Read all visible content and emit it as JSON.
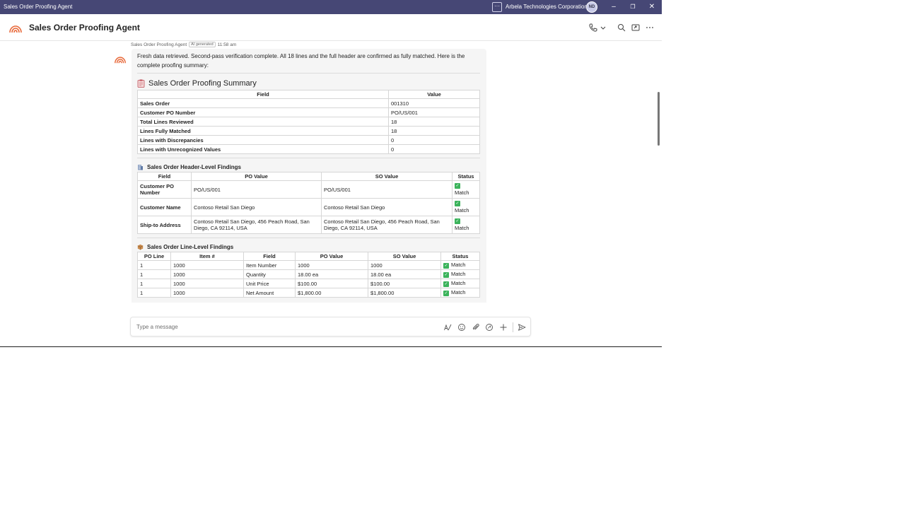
{
  "window": {
    "title": "Sales Order Proofing Agent",
    "org": "Arbela Technologies Corporation",
    "avatar_initials": "ND",
    "more_label": "···",
    "minimize_glyph": "–",
    "restore_glyph": "❐",
    "close_glyph": "✕"
  },
  "header": {
    "app_title": "Sales Order Proofing Agent",
    "icons": [
      "phone-icon",
      "chevron-down-icon",
      "search-icon",
      "popout-icon",
      "more-icon"
    ]
  },
  "message": {
    "sender": "Sales Order Proofing Agent",
    "ai_badge": "AI generated",
    "time": "11:58 am",
    "intro": "Fresh data retrieved. Second-pass verification complete. All 18 lines and the full header are confirmed as fully matched. Here is the complete proofing summary:"
  },
  "summary": {
    "title": "Sales Order Proofing Summary",
    "headers": [
      "Field",
      "Value"
    ],
    "rows": [
      [
        "Sales Order",
        "001310"
      ],
      [
        "Customer PO Number",
        "PO/US/001"
      ],
      [
        "Total Lines Reviewed",
        "18"
      ],
      [
        "Lines Fully Matched",
        "18"
      ],
      [
        "Lines with Discrepancies",
        "0"
      ],
      [
        "Lines with Unrecognized Values",
        "0"
      ]
    ]
  },
  "header_findings": {
    "title": "Sales Order Header-Level Findings",
    "headers": [
      "Field",
      "PO Value",
      "SO Value",
      "Status"
    ],
    "rows": [
      [
        "Customer PO Number",
        "PO/US/001",
        "PO/US/001",
        "Match"
      ],
      [
        "Customer Name",
        "Contoso Retail San Diego",
        "Contoso Retail San Diego",
        "Match"
      ],
      [
        "Ship-to Address",
        "Contoso Retail San Diego, 456 Peach Road, San Diego, CA 92114, USA",
        "Contoso Retail San Diego, 456 Peach Road, San Diego, CA 92114, USA",
        "Match"
      ]
    ]
  },
  "line_findings": {
    "title": "Sales Order Line-Level Findings",
    "headers": [
      "PO Line",
      "Item #",
      "Field",
      "PO Value",
      "SO Value",
      "Status"
    ],
    "rows": [
      [
        "1",
        "1000",
        "Item Number",
        "1000",
        "1000",
        "Match"
      ],
      [
        "1",
        "1000",
        "Quantity",
        "18.00 ea",
        "18.00 ea",
        "Match"
      ],
      [
        "1",
        "1000",
        "Unit Price",
        "$100.00",
        "$100.00",
        "Match"
      ],
      [
        "1",
        "1000",
        "Net Amount",
        "$1,800.00",
        "$1,800.00",
        "Match"
      ]
    ]
  },
  "composer": {
    "placeholder": "Type a message",
    "icons": [
      "format-icon",
      "emoji-icon",
      "attach-icon",
      "loop-icon",
      "plus-icon",
      "send-icon"
    ]
  },
  "colors": {
    "titlebar": "#464775",
    "match_green": "#3bb35b",
    "logo_orange": "#e8693a"
  }
}
